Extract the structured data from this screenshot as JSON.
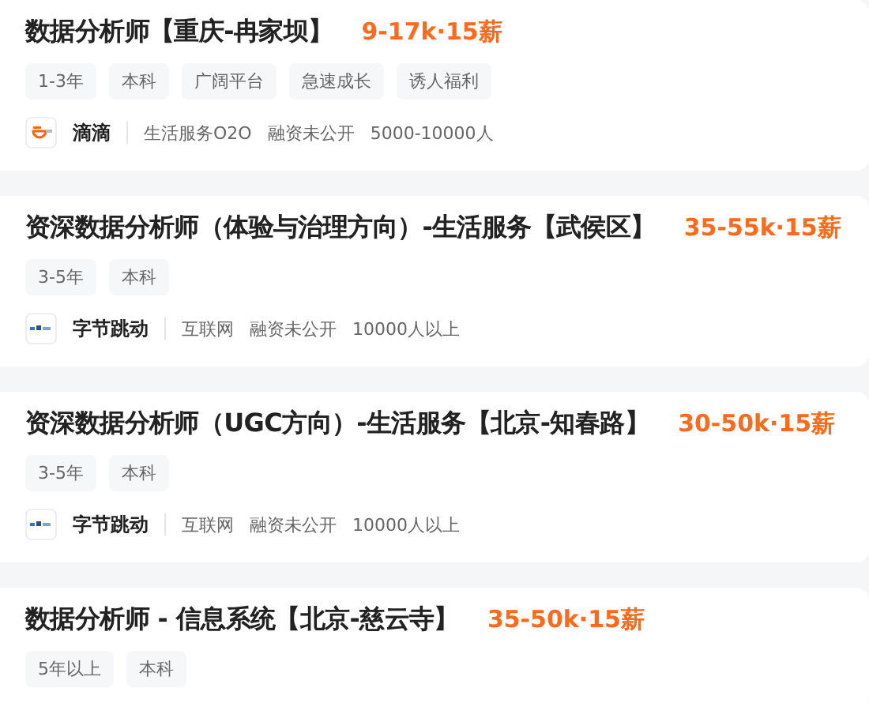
{
  "jobs": [
    {
      "title": "数据分析师【重庆-冉家坝】",
      "salary": "9-17k·15薪",
      "tags": [
        "1-3年",
        "本科",
        "广阔平台",
        "急速成长",
        "诱人福利"
      ],
      "company": {
        "name": "滴滴",
        "industry": "生活服务O2O",
        "funding": "融资未公开",
        "size": "5000-10000人"
      }
    },
    {
      "title": "资深数据分析师（体验与治理方向）-生活服务【武侯区】",
      "salary": "35-55k·15薪",
      "tags": [
        "3-5年",
        "本科"
      ],
      "company": {
        "name": "字节跳动",
        "industry": "互联网",
        "funding": "融资未公开",
        "size": "10000人以上"
      }
    },
    {
      "title": "资深数据分析师（UGC方向）-生活服务【北京-知春路】",
      "salary": "30-50k·15薪",
      "tags": [
        "3-5年",
        "本科"
      ],
      "company": {
        "name": "字节跳动",
        "industry": "互联网",
        "funding": "融资未公开",
        "size": "10000人以上"
      }
    },
    {
      "title": "数据分析师 - 信息系统【北京-慈云寺】",
      "salary": "35-50k·15薪",
      "tags": [
        "5年以上",
        "本科"
      ]
    }
  ]
}
